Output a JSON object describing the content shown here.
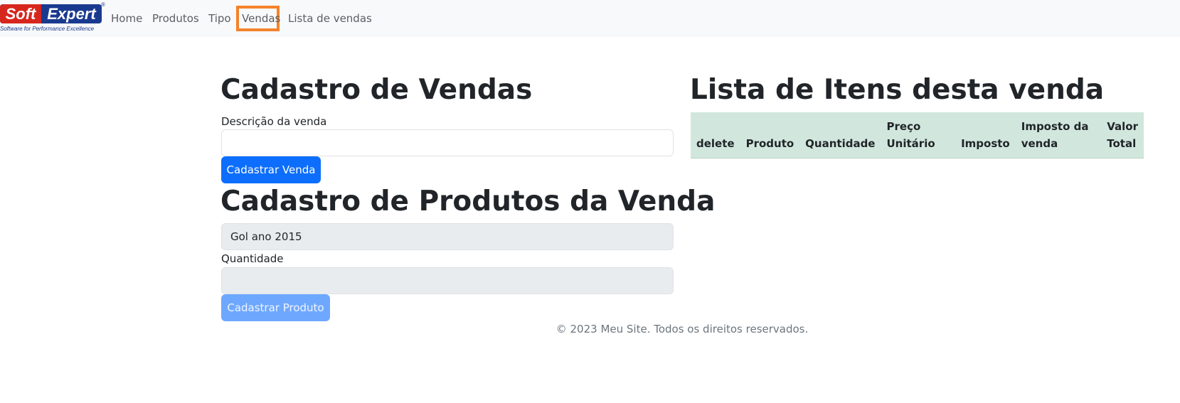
{
  "navbar": {
    "logo": {
      "brand_part1": "Soft",
      "brand_part2": "Expert",
      "registered": "®",
      "tagline": "Software for Performance Excellence"
    },
    "links": [
      {
        "label": "Home"
      },
      {
        "label": "Produtos"
      },
      {
        "label": "Tipo"
      },
      {
        "label": "Vendas",
        "active": true
      },
      {
        "label": "Lista de vendas"
      }
    ]
  },
  "sale_form": {
    "title": "Cadastro de Vendas",
    "description_label": "Descrição da venda",
    "description_value": "",
    "submit_label": "Cadastrar Venda"
  },
  "product_form": {
    "title": "Cadastro de Produtos da Venda",
    "product_value": "Gol ano 2015",
    "quantity_label": "Quantidade",
    "quantity_value": "",
    "submit_label": "Cadastrar Produto"
  },
  "items_table": {
    "title": "Lista de Itens desta venda",
    "columns": [
      "delete",
      "Produto",
      "Quantidade",
      "Preço Unitário",
      "Imposto",
      "Imposto da venda",
      "Valor Total"
    ],
    "rows": []
  },
  "footer": {
    "text": "© 2023 Meu Site. Todos os direitos reservados."
  },
  "colors": {
    "primary": "#0d6efd",
    "active_highlight": "#f5822b",
    "table_header": "#d1e7dd"
  }
}
